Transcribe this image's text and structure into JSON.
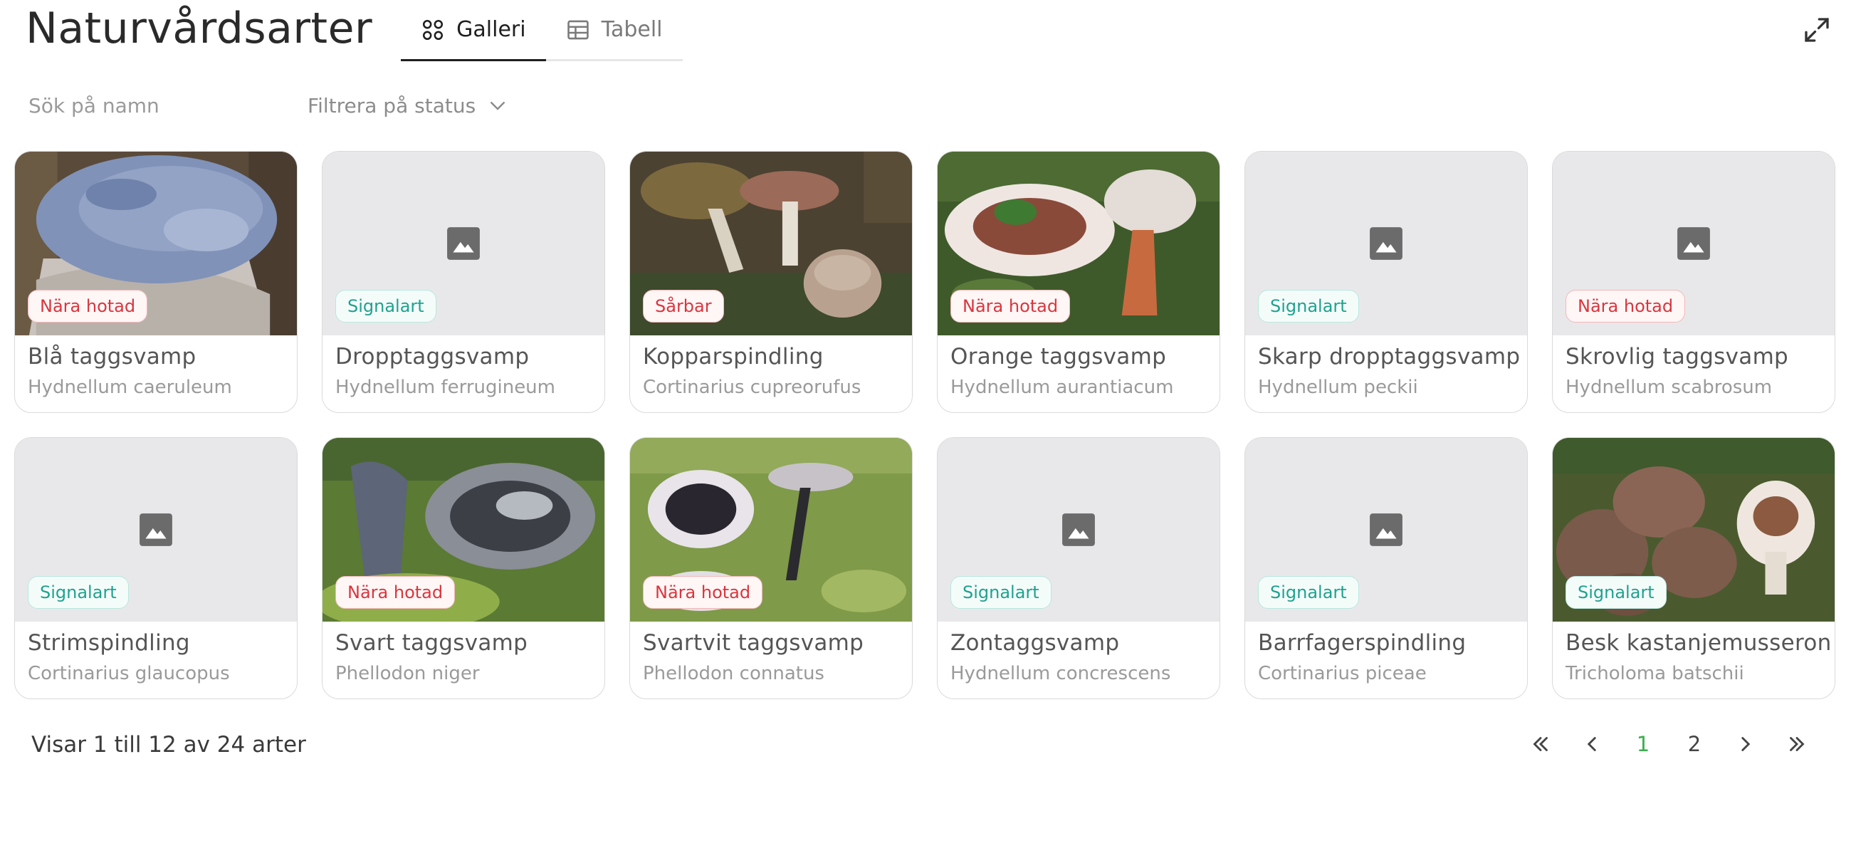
{
  "header": {
    "title": "Naturvårdsarter",
    "tabs": [
      {
        "label": "Galleri",
        "icon": "grid-icon",
        "active": true
      },
      {
        "label": "Tabell",
        "icon": "table-icon",
        "active": false
      }
    ],
    "expand_icon": "expand-icon"
  },
  "filters": {
    "search_placeholder": "Sök på namn",
    "status_label": "Filtrera på status"
  },
  "colors": {
    "red_badge": "#d9363e",
    "teal_badge": "#1fa28f",
    "current_page": "#3cae4e",
    "placeholder_bg": "#e8e8ea"
  },
  "cards": [
    {
      "common": "Blå taggsvamp",
      "latin": "Hydnellum caeruleum",
      "status": "Nära hotad",
      "status_color": "red",
      "image": "photo-blue"
    },
    {
      "common": "Dropptaggsvamp",
      "latin": "Hydnellum ferrugineum",
      "status": "Signalart",
      "status_color": "teal",
      "image": "placeholder"
    },
    {
      "common": "Kopparspindling",
      "latin": "Cortinarius cupreorufus",
      "status": "Sårbar",
      "status_color": "red",
      "image": "photo-copper"
    },
    {
      "common": "Orange taggsvamp",
      "latin": "Hydnellum aurantiacum",
      "status": "Nära hotad",
      "status_color": "red",
      "image": "photo-orange"
    },
    {
      "common": "Skarp dropptaggsvamp",
      "latin": "Hydnellum peckii",
      "status": "Signalart",
      "status_color": "teal",
      "image": "placeholder"
    },
    {
      "common": "Skrovlig taggsvamp",
      "latin": "Hydnellum scabrosum",
      "status": "Nära hotad",
      "status_color": "red",
      "image": "placeholder"
    },
    {
      "common": "Strimspindling",
      "latin": "Cortinarius glaucopus",
      "status": "Signalart",
      "status_color": "teal",
      "image": "placeholder"
    },
    {
      "common": "Svart taggsvamp",
      "latin": "Phellodon niger",
      "status": "Nära hotad",
      "status_color": "red",
      "image": "photo-black"
    },
    {
      "common": "Svartvit taggsvamp",
      "latin": "Phellodon connatus",
      "status": "Nära hotad",
      "status_color": "red",
      "image": "photo-blackwhite"
    },
    {
      "common": "Zontaggsvamp",
      "latin": "Hydnellum concrescens",
      "status": "Signalart",
      "status_color": "teal",
      "image": "placeholder"
    },
    {
      "common": "Barrfagerspindling",
      "latin": "Cortinarius piceae",
      "status": "Signalart",
      "status_color": "teal",
      "image": "placeholder"
    },
    {
      "common": "Besk kastanjemusseron",
      "latin": "Tricholoma batschii",
      "status": "Signalart",
      "status_color": "teal",
      "image": "photo-brown"
    }
  ],
  "footer": {
    "summary": "Visar 1 till 12 av 24 arter",
    "pages": [
      "1",
      "2"
    ],
    "current_page": "1"
  }
}
